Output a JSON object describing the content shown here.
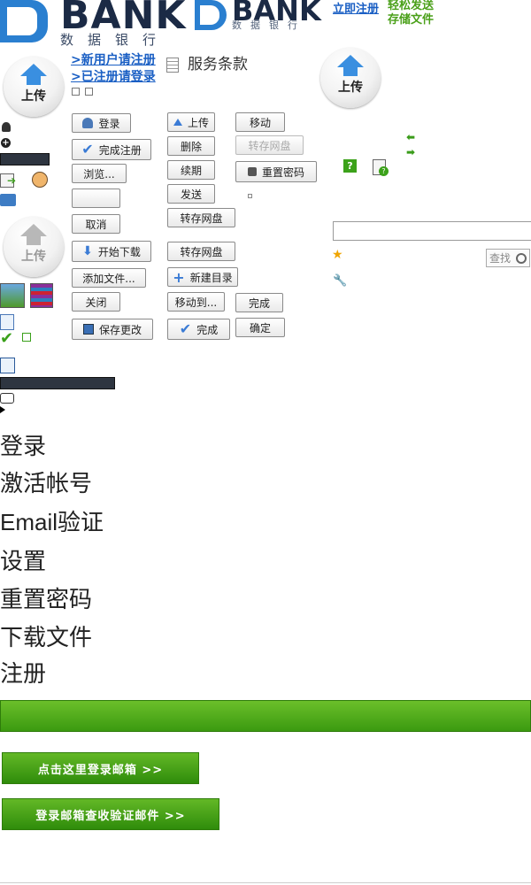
{
  "header": {
    "logo_text": "BANK",
    "logo_sub": "数据银行",
    "logo_small_text": "BANK",
    "logo_small_sub": "数据银行",
    "register_link": "立即注册",
    "slogan_line1": "轻松发送",
    "slogan_line2": "存储文件"
  },
  "upload": {
    "label": "上传"
  },
  "links": {
    "new_user": "新用户请注册",
    "existing_user": "已注册请登录",
    "terms": "服务条款"
  },
  "buttons": {
    "login": "登录",
    "finish_register": "完成注册",
    "browse": "浏览...",
    "empty": "",
    "cancel": "取消",
    "start_download": "开始下载",
    "add_file": "添加文件...",
    "close": "关闭",
    "save_changes": "保存更改",
    "upload": "上传",
    "delete": "删除",
    "renew": "续期",
    "send": "发送",
    "transfer_disk_1": "转存网盘",
    "transfer_disk_2": "转存网盘",
    "new_folder": "新建目录",
    "move_to": "移动到...",
    "done_check": "完成",
    "move": "移动",
    "transfer_disk_disabled": "转存网盘",
    "reset_password": "重置密码",
    "done": "完成",
    "ok": "确定"
  },
  "search": {
    "button": "查找",
    "value": ""
  },
  "menu": {
    "items": [
      "登录",
      "激活帐号",
      "Email验证",
      "设置",
      "重置密码",
      "下载文件",
      "注册"
    ]
  },
  "green_buttons": {
    "login_mail": "点击这里登录邮箱 >>",
    "check_mail": "登录邮箱查收验证邮件 >>"
  },
  "colors": {
    "accent_blue": "#2a7fd0",
    "link_blue": "#1a5fc4",
    "green": "#4aa019"
  }
}
